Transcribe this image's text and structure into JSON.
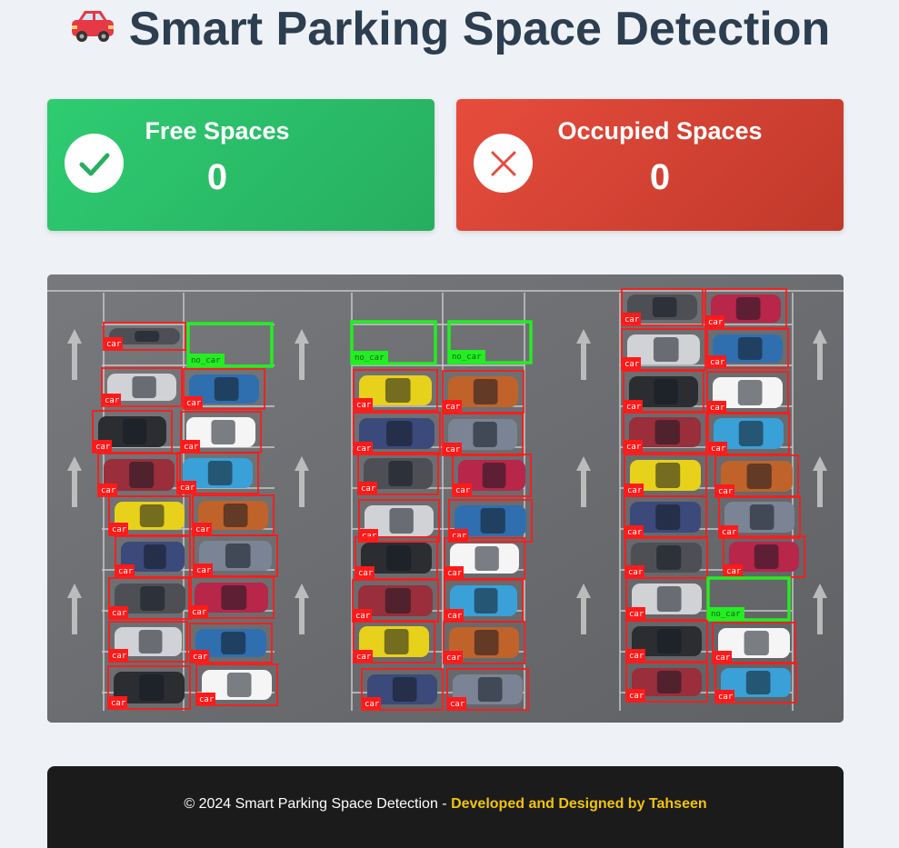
{
  "header": {
    "title": "Smart Parking Space Detection",
    "icon": "red-car-icon"
  },
  "stats": {
    "free": {
      "label": "Free Spaces",
      "count": "0",
      "icon": "check-icon",
      "color": "#2ecc71"
    },
    "occupied": {
      "label": "Occupied Spaces",
      "count": "0",
      "icon": "x-icon",
      "color": "#e74c3c"
    }
  },
  "detection": {
    "car_label": "car",
    "empty_label": "no_car",
    "car_box_color": "#ff1a1a",
    "empty_box_color": "#22ee22"
  },
  "footer": {
    "text": "© 2024 Smart Parking Space Detection - ",
    "credit": "Developed and Designed by Tahseen",
    "credit_color": "#f1c40f"
  }
}
